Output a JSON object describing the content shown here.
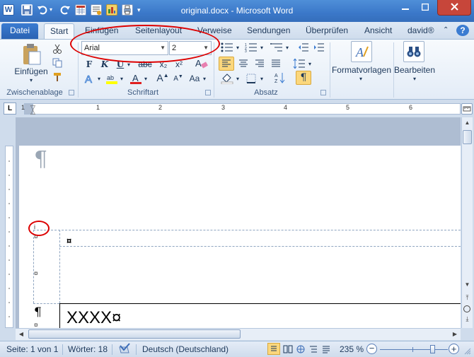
{
  "window": {
    "title": "original.docx - Microsoft Word",
    "app_icon": "W"
  },
  "quick_access": [
    "save-icon",
    "undo-icon",
    "redo-icon",
    "table-icon",
    "insert-icon",
    "chart-icon",
    "print-icon",
    "customize-icon"
  ],
  "ribbon_tabs": [
    "Datei",
    "Start",
    "Einfügen",
    "Seitenlayout",
    "Verweise",
    "Sendungen",
    "Überprüfen",
    "Ansicht",
    "david®"
  ],
  "clipboard": {
    "paste_label": "Einfügen",
    "group_label": "Zwischenablage"
  },
  "font": {
    "font_name": "Arial",
    "font_size": "2",
    "bold": "F",
    "italic": "K",
    "underline": "U",
    "strikethrough": "abc",
    "subscript": "x₂",
    "superscript": "x²",
    "grow": "A",
    "shrink": "A",
    "case": "Aa",
    "group_label": "Schriftart"
  },
  "paragraph": {
    "group_label": "Absatz",
    "show_marks": "¶"
  },
  "styles": {
    "label": "Formatvorlagen"
  },
  "editing": {
    "label": "Bearbeiten"
  },
  "ruler": {
    "numbers": [
      "1",
      "1",
      "2",
      "3",
      "4",
      "5",
      "6"
    ]
  },
  "document": {
    "pilcrow": "¶",
    "cell_mark": "¤",
    "move_mark": "¤",
    "text": "XXXX¤",
    "small_i": "i"
  },
  "status": {
    "page": "Seite: 1 von 1",
    "words": "Wörter: 18",
    "language": "Deutsch (Deutschland)",
    "zoom": "235 %",
    "zoom_level": 0.78
  },
  "colors": {
    "title_bar": "#3b78c9",
    "file_tab": "#2a62b3",
    "annotation": "#dd0000"
  }
}
